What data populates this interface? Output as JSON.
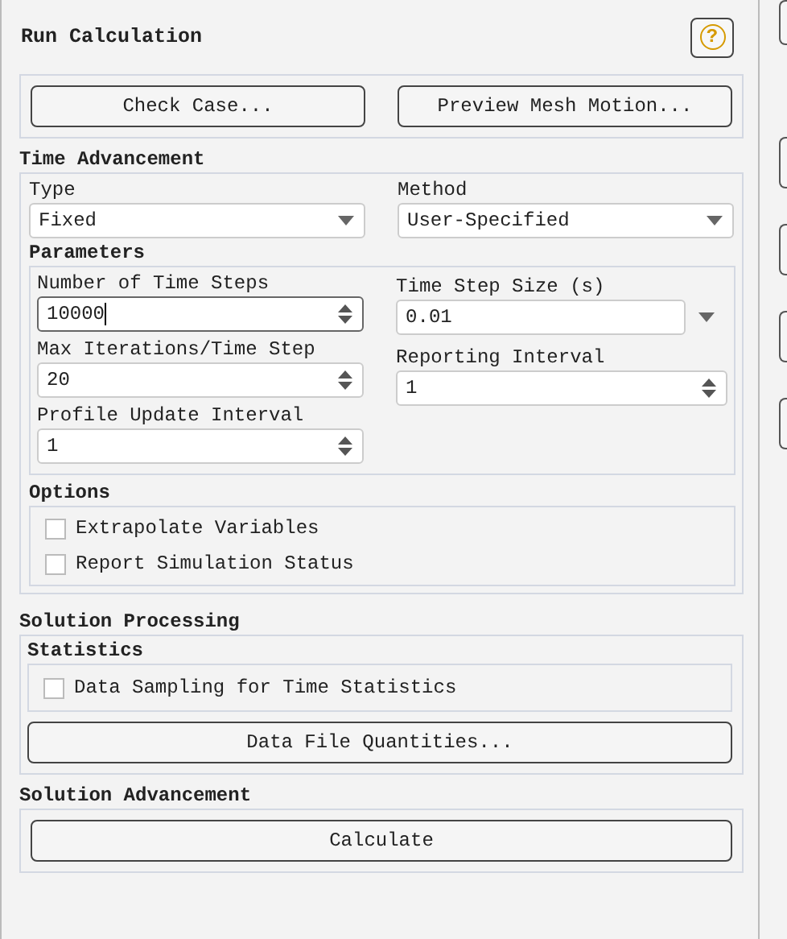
{
  "title": "Run Calculation",
  "help": {
    "label": "?"
  },
  "top_buttons": [
    "Check Case...",
    "Preview Mesh Motion..."
  ],
  "time_advancement": {
    "heading": "Time Advancement",
    "selectors": [
      {
        "label": "Type",
        "value": "Fixed"
      },
      {
        "label": "Method",
        "value": "User-Specified"
      }
    ],
    "parameters": {
      "heading": "Parameters",
      "columns": [
        [
          {
            "label": "Number of Time Steps",
            "value": "10000",
            "kind": "spinner",
            "focused": true
          },
          {
            "label": "Max Iterations/Time Step",
            "value": "20",
            "kind": "spinner",
            "focused": false
          },
          {
            "label": "Profile Update Interval",
            "value": "1",
            "kind": "spinner",
            "focused": false
          }
        ],
        [
          {
            "label": "Time Step Size (s)",
            "value": "0.01",
            "kind": "dropdown-entry",
            "focused": false
          },
          {
            "label": "Reporting Interval",
            "value": "1",
            "kind": "spinner",
            "focused": false
          }
        ]
      ]
    },
    "options": {
      "heading": "Options",
      "items": [
        {
          "label": "Extrapolate Variables",
          "checked": false
        },
        {
          "label": "Report Simulation Status",
          "checked": false
        }
      ]
    }
  },
  "solution_processing": {
    "heading": "Solution Processing",
    "statistics": {
      "heading": "Statistics",
      "items": [
        {
          "label": "Data Sampling for Time Statistics",
          "checked": false
        }
      ]
    },
    "button": "Data File Quantities..."
  },
  "solution_advancement": {
    "heading": "Solution Advancement",
    "button": "Calculate"
  }
}
